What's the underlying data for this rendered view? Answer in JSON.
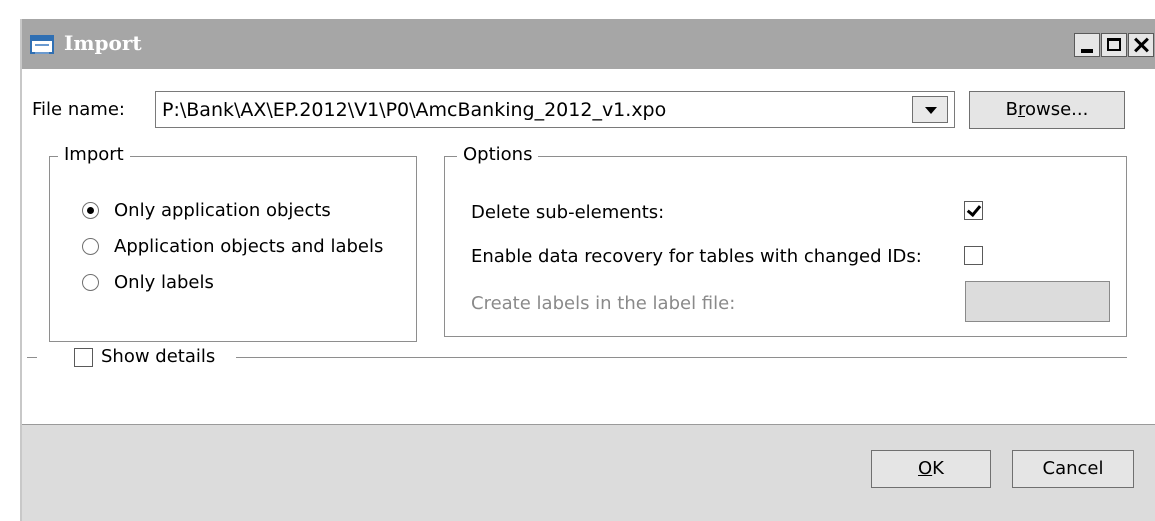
{
  "window": {
    "title": "Import"
  },
  "file": {
    "label": "File name:",
    "value": "P:\\Bank\\AX\\EP.2012\\V1\\P0\\AmcBanking_2012_v1.xpo",
    "browse_pre": "B",
    "browse_mnemonic": "r",
    "browse_post": "owse..."
  },
  "import_group": {
    "legend": "Import",
    "options": [
      {
        "label": "Only application objects",
        "selected": true
      },
      {
        "label": "Application objects and labels",
        "selected": false
      },
      {
        "label": "Only labels",
        "selected": false
      }
    ]
  },
  "options_group": {
    "legend": "Options",
    "delete_sub": {
      "label": "Delete sub-elements:",
      "checked": true
    },
    "data_recovery": {
      "label": "Enable data recovery for tables with changed IDs:",
      "checked": false
    },
    "create_labels": {
      "label": "Create labels in the label file:",
      "value": ""
    }
  },
  "details": {
    "label": "Show details",
    "checked": false
  },
  "footer": {
    "ok_mnemonic": "O",
    "ok_rest": "K",
    "cancel": "Cancel"
  }
}
